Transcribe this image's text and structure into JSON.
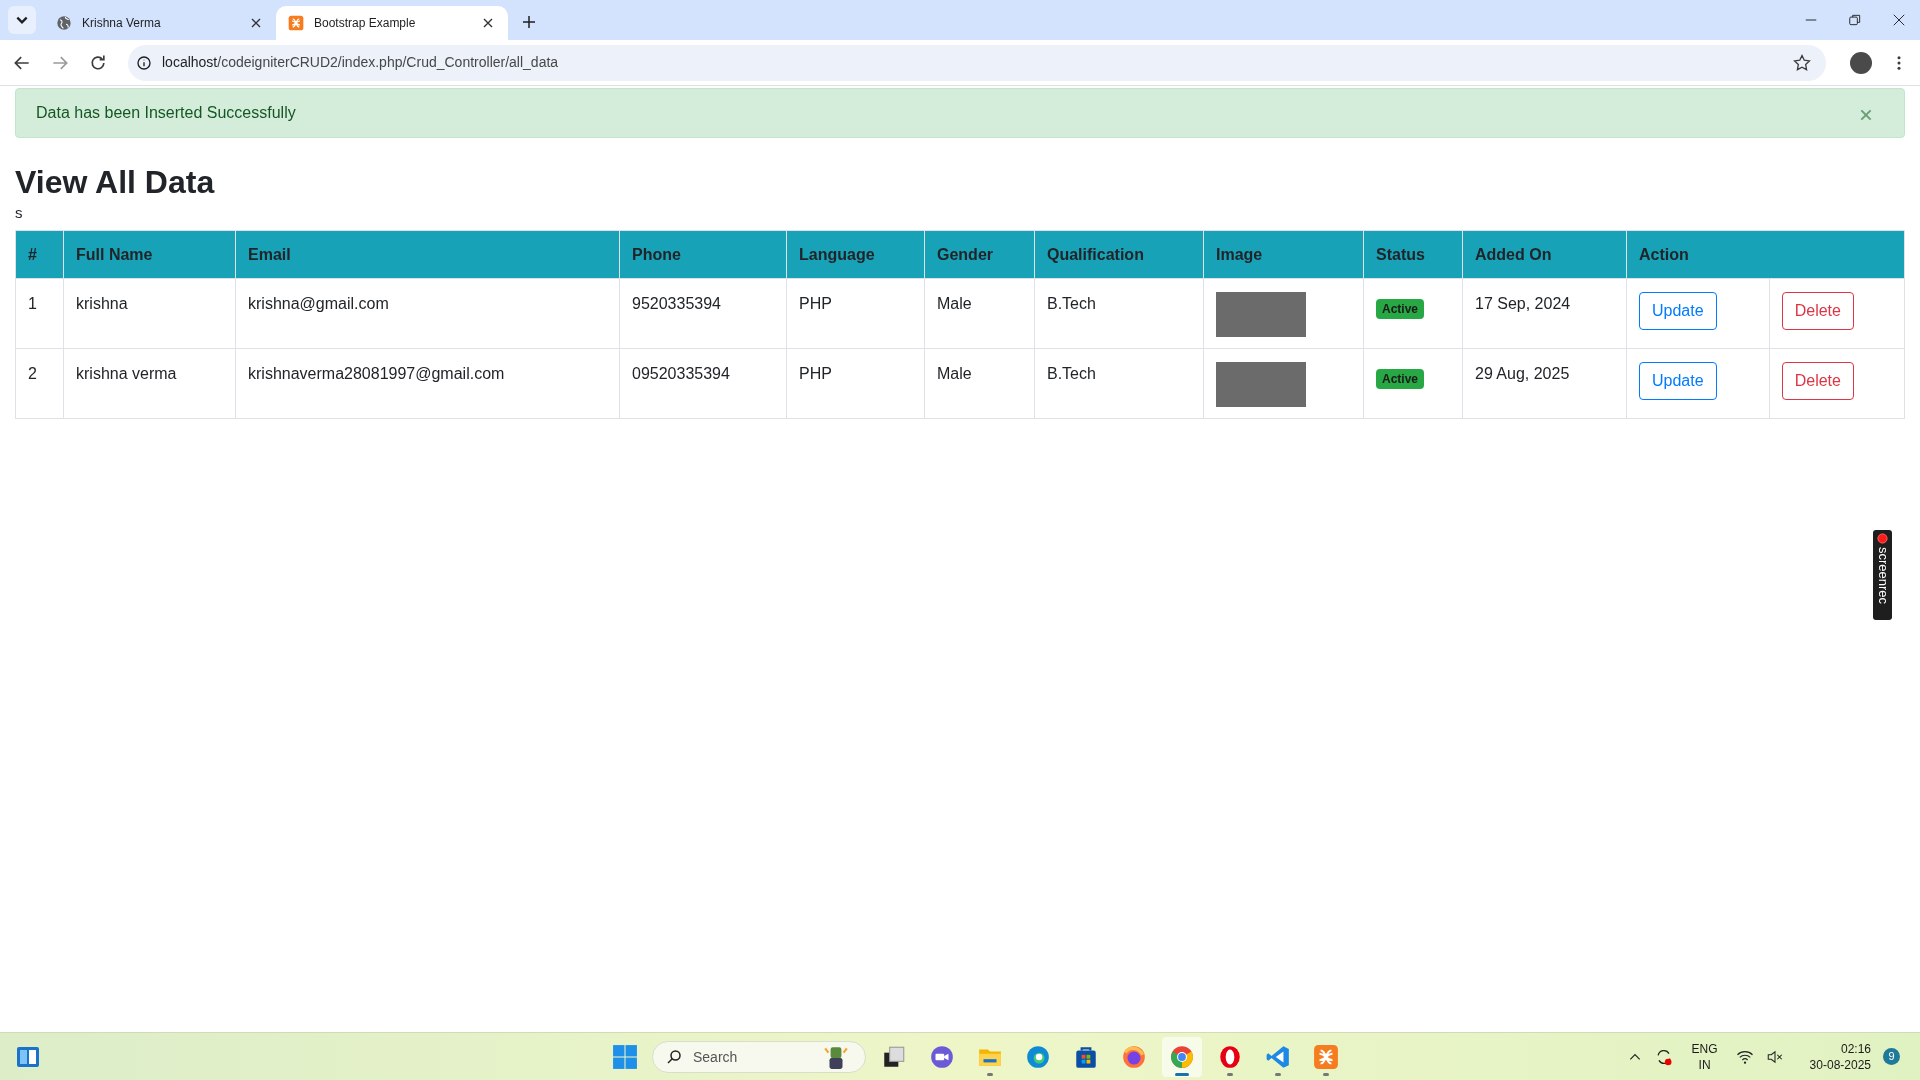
{
  "browser": {
    "tabs": [
      {
        "title": "Krishna Verma",
        "kind": "globe",
        "selected": false
      },
      {
        "title": "Bootstrap Example",
        "kind": "xampp",
        "selected": true
      }
    ],
    "address": {
      "host": "localhost",
      "path": "/codeigniterCRUD2/index.php/Crud_Controller/all_data"
    }
  },
  "alert": {
    "message": "Data has been Inserted Successfully",
    "dismissible": true
  },
  "heading": "View All Data",
  "note": "s",
  "table": {
    "columns": [
      "#",
      "Full Name",
      "Email",
      "Phone",
      "Language",
      "Gender",
      "Qualification",
      "Image",
      "Status",
      "Added On",
      "Action"
    ],
    "rows": [
      {
        "cells": [
          "1",
          "krishna",
          "krishna@gmail.com",
          "9520335394",
          "PHP",
          "Male",
          "B.Tech"
        ],
        "status": "Active",
        "added_on": "17 Sep, 2024",
        "update": "Update",
        "delete": "Delete"
      },
      {
        "cells": [
          "2",
          "krishna verma",
          "krishnaverma28081997@gmail.com",
          "09520335394",
          "PHP",
          "Male",
          "B.Tech"
        ],
        "status": "Active",
        "added_on": "29 Aug, 2025",
        "update": "Update",
        "delete": "Delete"
      }
    ]
  },
  "screenrec": {
    "label": "screenrec"
  },
  "taskbar": {
    "search_placeholder": "Search",
    "apps": [
      {
        "kind": "taskview",
        "running": false,
        "selected": false
      },
      {
        "kind": "chat",
        "running": false,
        "selected": false
      },
      {
        "kind": "folder",
        "running": true,
        "selected": false
      },
      {
        "kind": "edge",
        "running": false,
        "selected": false
      },
      {
        "kind": "store",
        "running": false,
        "selected": false
      },
      {
        "kind": "firefox",
        "running": false,
        "selected": false
      },
      {
        "kind": "chrome",
        "running": true,
        "selected": true
      },
      {
        "kind": "opera",
        "running": true,
        "selected": false
      },
      {
        "kind": "vscode",
        "running": true,
        "selected": false
      },
      {
        "kind": "xampp",
        "running": true,
        "selected": false
      }
    ],
    "language": [
      "ENG",
      "IN"
    ],
    "time": "02:16",
    "date": "30-08-2025",
    "notifications": "9"
  }
}
